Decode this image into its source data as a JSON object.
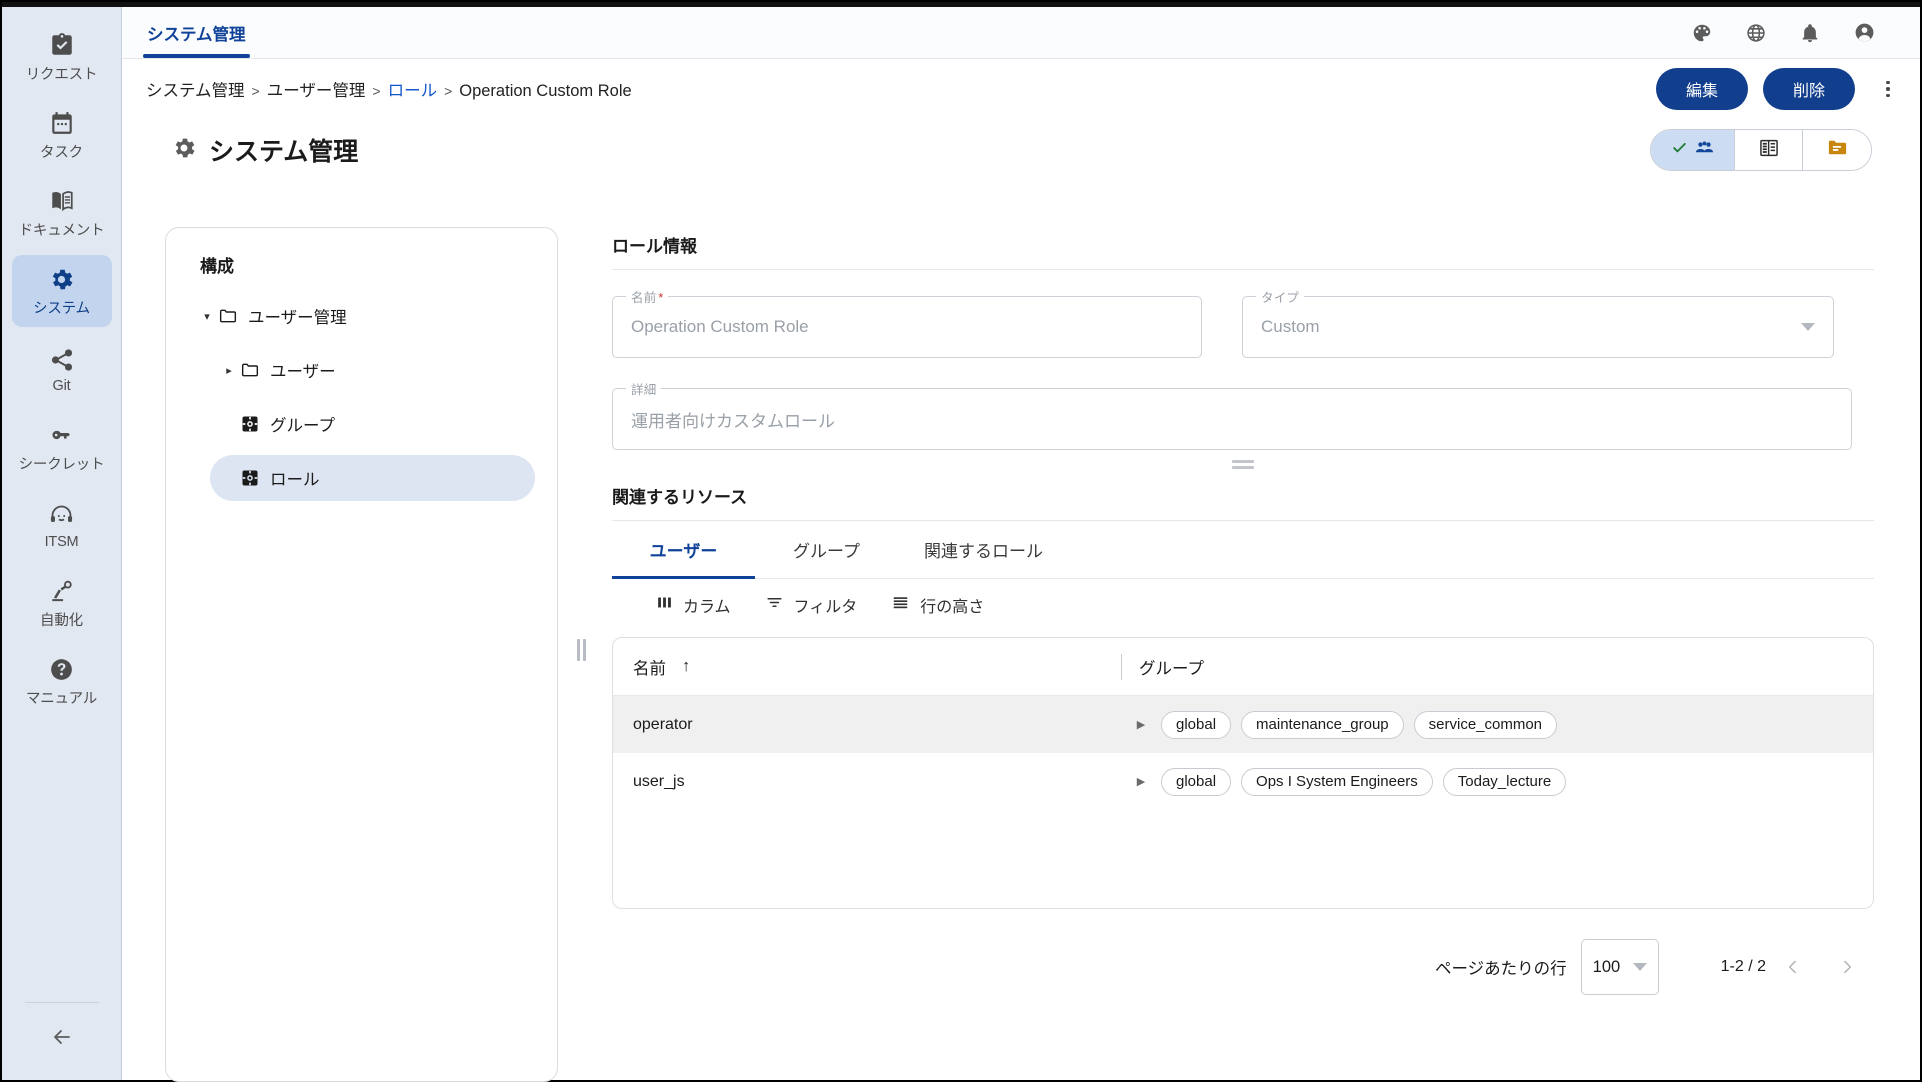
{
  "sidebar": {
    "items": [
      {
        "label": "リクエスト",
        "icon": "clipboard-check-icon",
        "active": false
      },
      {
        "label": "タスク",
        "icon": "calendar-icon",
        "active": false
      },
      {
        "label": "ドキュメント",
        "icon": "book-icon",
        "active": false
      },
      {
        "label": "システム",
        "icon": "gear-icon",
        "active": true
      },
      {
        "label": "Git",
        "icon": "share-icon",
        "active": false
      },
      {
        "label": "シークレット",
        "icon": "key-icon",
        "active": false
      },
      {
        "label": "ITSM",
        "icon": "headset-icon",
        "active": false
      },
      {
        "label": "自動化",
        "icon": "robot-arm-icon",
        "active": false
      },
      {
        "label": "マニュアル",
        "icon": "question-circle-icon",
        "active": false
      }
    ],
    "collapse_label": "back-arrow"
  },
  "header": {
    "tab_label": "システム管理",
    "icons": [
      "palette-icon",
      "globe-icon",
      "bell-icon",
      "account-icon"
    ]
  },
  "breadcrumb": {
    "items": [
      {
        "text": "システム管理",
        "link": false
      },
      {
        "text": "ユーザー管理",
        "link": false
      },
      {
        "text": "ロール",
        "link": true
      },
      {
        "text": "Operation Custom Role",
        "link": false
      }
    ],
    "sep": ">"
  },
  "actions": {
    "edit_label": "編集",
    "delete_label": "削除",
    "more_label": "more-options"
  },
  "page": {
    "title": "システム管理",
    "title_icon": "gear-icon"
  },
  "view_toggle": {
    "options": [
      {
        "name": "users-view",
        "icon": "people-icon",
        "checked": true
      },
      {
        "name": "org-view",
        "icon": "building-list-icon",
        "checked": false
      },
      {
        "name": "folder-view",
        "icon": "folder-icon",
        "checked": false
      }
    ]
  },
  "tree": {
    "title": "構成",
    "nodes": [
      {
        "label": "ユーザー管理",
        "icon": "folder-icon",
        "caret": "▾",
        "level": 1,
        "selected": false
      },
      {
        "label": "ユーザー",
        "icon": "folder-icon",
        "caret": "▸",
        "level": 2,
        "selected": false
      },
      {
        "label": "グループ",
        "icon": "settings-square-icon",
        "caret": "",
        "level": 2,
        "selected": false
      },
      {
        "label": "ロール",
        "icon": "settings-square-icon",
        "caret": "",
        "level": 2,
        "selected": true
      }
    ]
  },
  "role_info": {
    "section_title": "ロール情報",
    "name": {
      "label": "名前",
      "required": true,
      "value": "Operation Custom Role"
    },
    "type": {
      "label": "タイプ",
      "required": false,
      "value": "Custom"
    },
    "detail": {
      "label": "詳細",
      "required": false,
      "value": "運用者向けカスタムロール"
    }
  },
  "related": {
    "section_title": "関連するリソース",
    "tabs": [
      {
        "label": "ユーザー",
        "active": true
      },
      {
        "label": "グループ",
        "active": false
      },
      {
        "label": "関連するロール",
        "active": false
      }
    ],
    "toolbar": [
      {
        "label": "カラム",
        "icon": "columns-icon"
      },
      {
        "label": "フィルタ",
        "icon": "filter-icon"
      },
      {
        "label": "行の高さ",
        "icon": "density-icon"
      }
    ],
    "table": {
      "columns": [
        {
          "label": "名前",
          "sort": "↑"
        },
        {
          "label": "グループ",
          "sort": ""
        }
      ],
      "rows": [
        {
          "name": "operator",
          "groups": [
            "global",
            "maintenance_group",
            "service_common"
          ]
        },
        {
          "name": "user_js",
          "groups": [
            "global",
            "Ops I System Engineers",
            "Today_lecture"
          ]
        }
      ]
    },
    "pagination": {
      "rows_per_page_label": "ページあたりの行",
      "rows_per_page_value": "100",
      "range": "1-2 / 2",
      "prev_label": "‹",
      "next_label": "›"
    }
  },
  "colors": {
    "brand_blue": "#0f4298",
    "button_blue": "#113f8e",
    "sidebar_bg": "#e2e8f2",
    "active_item": "#c3d5ee",
    "link_blue": "#1357c9",
    "check_green": "#1f7a33",
    "required_red": "#c0392b"
  }
}
